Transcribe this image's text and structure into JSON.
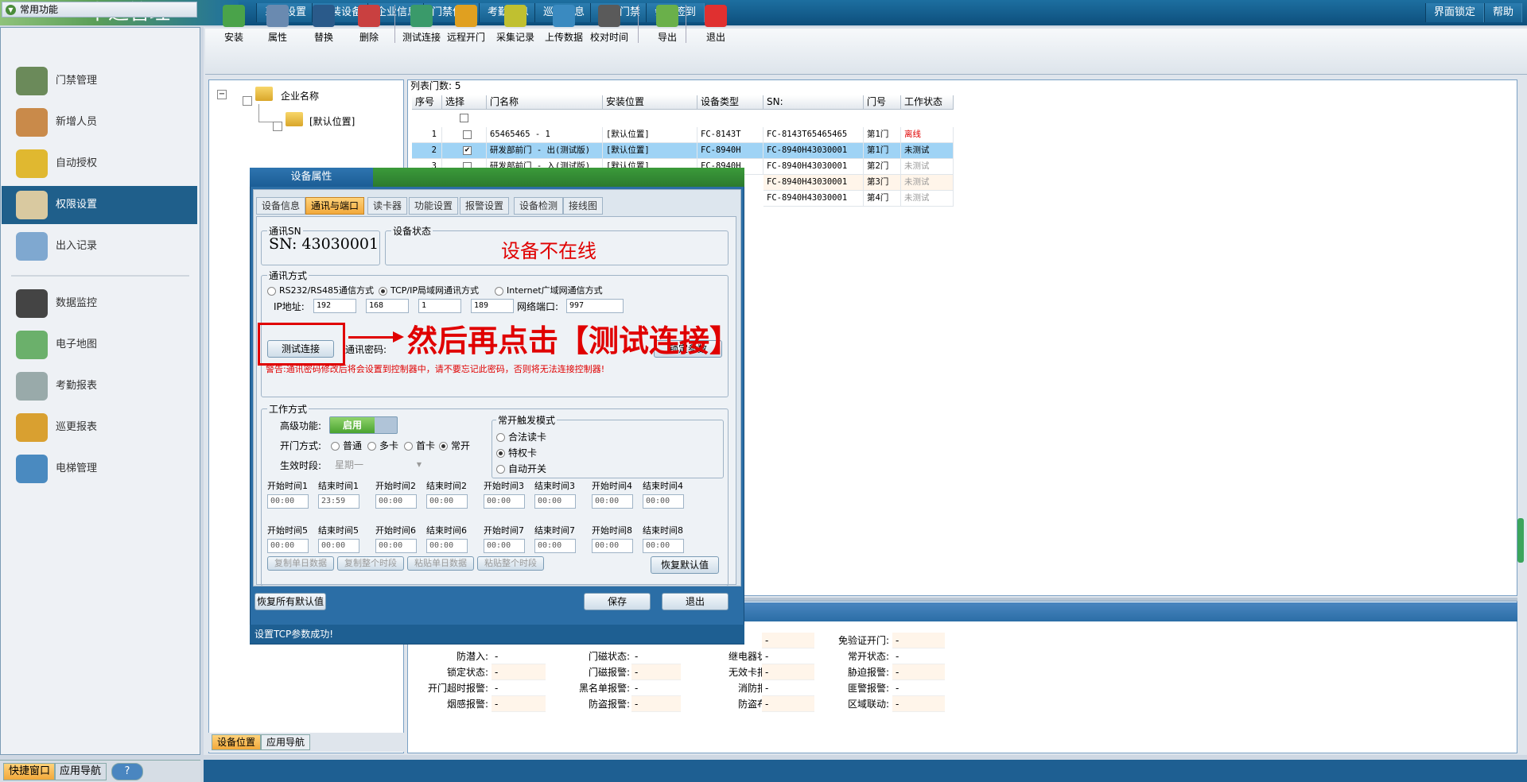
{
  "app": {
    "title": "一卡通管理"
  },
  "topmenu": [
    "系统设置",
    "安装设备",
    "企业信息",
    "门禁信息",
    "考勤信息",
    "巡更信息",
    "电梯门禁",
    "会议签到"
  ],
  "topright": {
    "lock": "界面锁定",
    "help": "帮助"
  },
  "leftpanel": {
    "header": "常用功能",
    "items": [
      {
        "label": "门禁管理",
        "icon": "door-access-icon"
      },
      {
        "label": "新增人员",
        "icon": "person-icon"
      },
      {
        "label": "自动授权",
        "icon": "card-icon"
      },
      {
        "label": "权限设置",
        "icon": "permission-doc-icon",
        "active": true
      },
      {
        "label": "出入记录",
        "icon": "magnifier-icon"
      },
      {
        "label": "数据监控",
        "icon": "camera-icon"
      },
      {
        "label": "电子地图",
        "icon": "map-icon"
      },
      {
        "label": "考勤报表",
        "icon": "clock-icon"
      },
      {
        "label": "巡更报表",
        "icon": "patrol-icon"
      },
      {
        "label": "电梯管理",
        "icon": "elevator-icon"
      }
    ],
    "bottom": [
      "快捷窗口",
      "应用导航",
      "?"
    ]
  },
  "toolbar": [
    "安装",
    "属性",
    "替换",
    "删除",
    "测试连接",
    "远程开门",
    "采集记录",
    "上传数据",
    "校对时间",
    "导出",
    "退出"
  ],
  "tree": {
    "root": "企业名称",
    "child": "[默认位置]",
    "tabs": [
      "设备位置",
      "应用导航"
    ]
  },
  "table": {
    "count_label": "列表门数: 5",
    "headers": [
      "序号",
      "选择",
      "门名称",
      "安装位置",
      "设备类型",
      "SN:",
      "门号",
      "工作状态"
    ],
    "rows": [
      {
        "no": "1",
        "checked": false,
        "name": "65465465 - 1",
        "location": "[默认位置]",
        "type": "FC-8143T",
        "sn": "FC-8143T65465465",
        "door": "第1门",
        "status": "离线",
        "status_color": "#e00000"
      },
      {
        "no": "2",
        "checked": true,
        "name": "研发部前门 - 出(测试版)",
        "location": "[默认位置]",
        "type": "FC-8940H",
        "sn": "FC-8940H43030001",
        "door": "第1门",
        "status": "未测试",
        "status_color": "#000000",
        "selected": true
      },
      {
        "no": "3",
        "checked": false,
        "name": "研发部前门 - 入(测试版)",
        "location": "[默认位置]",
        "type": "FC-8940H",
        "sn": "FC-8940H43030001",
        "door": "第2门",
        "status": "未测试",
        "status_color": "#999999"
      },
      {
        "no": "",
        "checked": false,
        "name": "",
        "location": "",
        "type": "",
        "sn": "FC-8940H43030001",
        "door": "第3门",
        "status": "未测试",
        "status_color": "#999999"
      },
      {
        "no": "",
        "checked": false,
        "name": "",
        "location": "",
        "type": "",
        "sn": "FC-8940H43030001",
        "door": "第4门",
        "status": "未测试",
        "status_color": "#999999"
      }
    ]
  },
  "status_panel": {
    "rows": [
      [
        {
          "l": "",
          "v": ""
        },
        {
          "l": "",
          "v": ""
        },
        {
          "l": ":",
          "v": "-"
        },
        {
          "l": "免验证开门:",
          "v": "-"
        }
      ],
      [
        {
          "l": "防潜入:",
          "v": "-"
        },
        {
          "l": "门磁状态:",
          "v": "-"
        },
        {
          "l": "继电器状态:",
          "v": "-"
        },
        {
          "l": "常开状态:",
          "v": "-"
        }
      ],
      [
        {
          "l": "锁定状态:",
          "v": "-"
        },
        {
          "l": "门磁报警:",
          "v": "-"
        },
        {
          "l": "无效卡报警:",
          "v": "-"
        },
        {
          "l": "胁迫报警:",
          "v": "-"
        }
      ],
      [
        {
          "l": "开门超时报警:",
          "v": "-"
        },
        {
          "l": "黑名单报警:",
          "v": "-"
        },
        {
          "l": "消防报警:",
          "v": "-"
        },
        {
          "l": "匪警报警:",
          "v": "-"
        }
      ],
      [
        {
          "l": "烟感报警:",
          "v": "-"
        },
        {
          "l": "防盗报警:",
          "v": "-"
        },
        {
          "l": "防盗布防:",
          "v": "-"
        },
        {
          "l": "区域联动:",
          "v": "-"
        }
      ]
    ]
  },
  "dialog": {
    "title": "设备属性",
    "tabs": [
      "设备信息",
      "通讯与端口",
      "读卡器",
      "功能设置",
      "报警设置",
      "设备检测",
      "接线图"
    ],
    "active_tab": 1,
    "sn_group": "通讯SN",
    "sn_value": "SN: 43030001",
    "status_group": "设备状态",
    "status_text": "设备不在线",
    "comm_group": "通讯方式",
    "comm_options": [
      "RS232/RS485通信方式",
      "TCP/IP局域网通讯方式",
      "Internet广域网通信方式"
    ],
    "comm_selected": 1,
    "ip_label": "IP地址:",
    "ip": [
      "192",
      "168",
      "1",
      "189"
    ],
    "port_label": "网络端口:",
    "port": "997",
    "test_button": "测试连接",
    "password_label": "通讯密码:",
    "lock_button": "锁定参数",
    "warning": "警告:通讯密码修改后将会设置到控制器中，请不要忘记此密码，否则将无法连接控制器!",
    "annotation": "然后再点击【测试连接】",
    "work_group": "工作方式",
    "advanced_label": "高级功能:",
    "advanced_toggle": "启用",
    "open_mode_label": "开门方式:",
    "open_modes": [
      "普通",
      "多卡",
      "首卡",
      "常开"
    ],
    "open_mode_selected": 3,
    "period_label": "生效时段:",
    "period_value": "星期一",
    "trigger_group": "常开触发模式",
    "trigger_options": [
      "合法读卡",
      "特权卡",
      "自动开关"
    ],
    "trigger_selected": 1,
    "times_row1": [
      {
        "label": "开始时间1",
        "value": "00:00"
      },
      {
        "label": "结束时间1",
        "value": "23:59"
      },
      {
        "label": "开始时间2",
        "value": "00:00"
      },
      {
        "label": "结束时间2",
        "value": "00:00"
      },
      {
        "label": "开始时间3",
        "value": "00:00"
      },
      {
        "label": "结束时间3",
        "value": "00:00"
      },
      {
        "label": "开始时间4",
        "value": "00:00"
      },
      {
        "label": "结束时间4",
        "value": "00:00"
      }
    ],
    "times_row2": [
      {
        "label": "开始时间5",
        "value": "00:00"
      },
      {
        "label": "结束时间5",
        "value": "00:00"
      },
      {
        "label": "开始时间6",
        "value": "00:00"
      },
      {
        "label": "结束时间6",
        "value": "00:00"
      },
      {
        "label": "开始时间7",
        "value": "00:00"
      },
      {
        "label": "结束时间7",
        "value": "00:00"
      },
      {
        "label": "开始时间8",
        "value": "00:00"
      },
      {
        "label": "结束时间8",
        "value": "00:00"
      }
    ],
    "copy_buttons": [
      "复制单日数据",
      "复制整个时段",
      "粘贴单日数据",
      "粘贴整个时段"
    ],
    "restore_default": "恢复默认值",
    "restore_all": "恢复所有默认值",
    "save": "保存",
    "exit": "退出",
    "status_bar": "设置TCP参数成功!"
  },
  "colors": {
    "accent": "#1e5f92",
    "annotation": "#e00000",
    "selected_row": "#9fd3f5"
  }
}
